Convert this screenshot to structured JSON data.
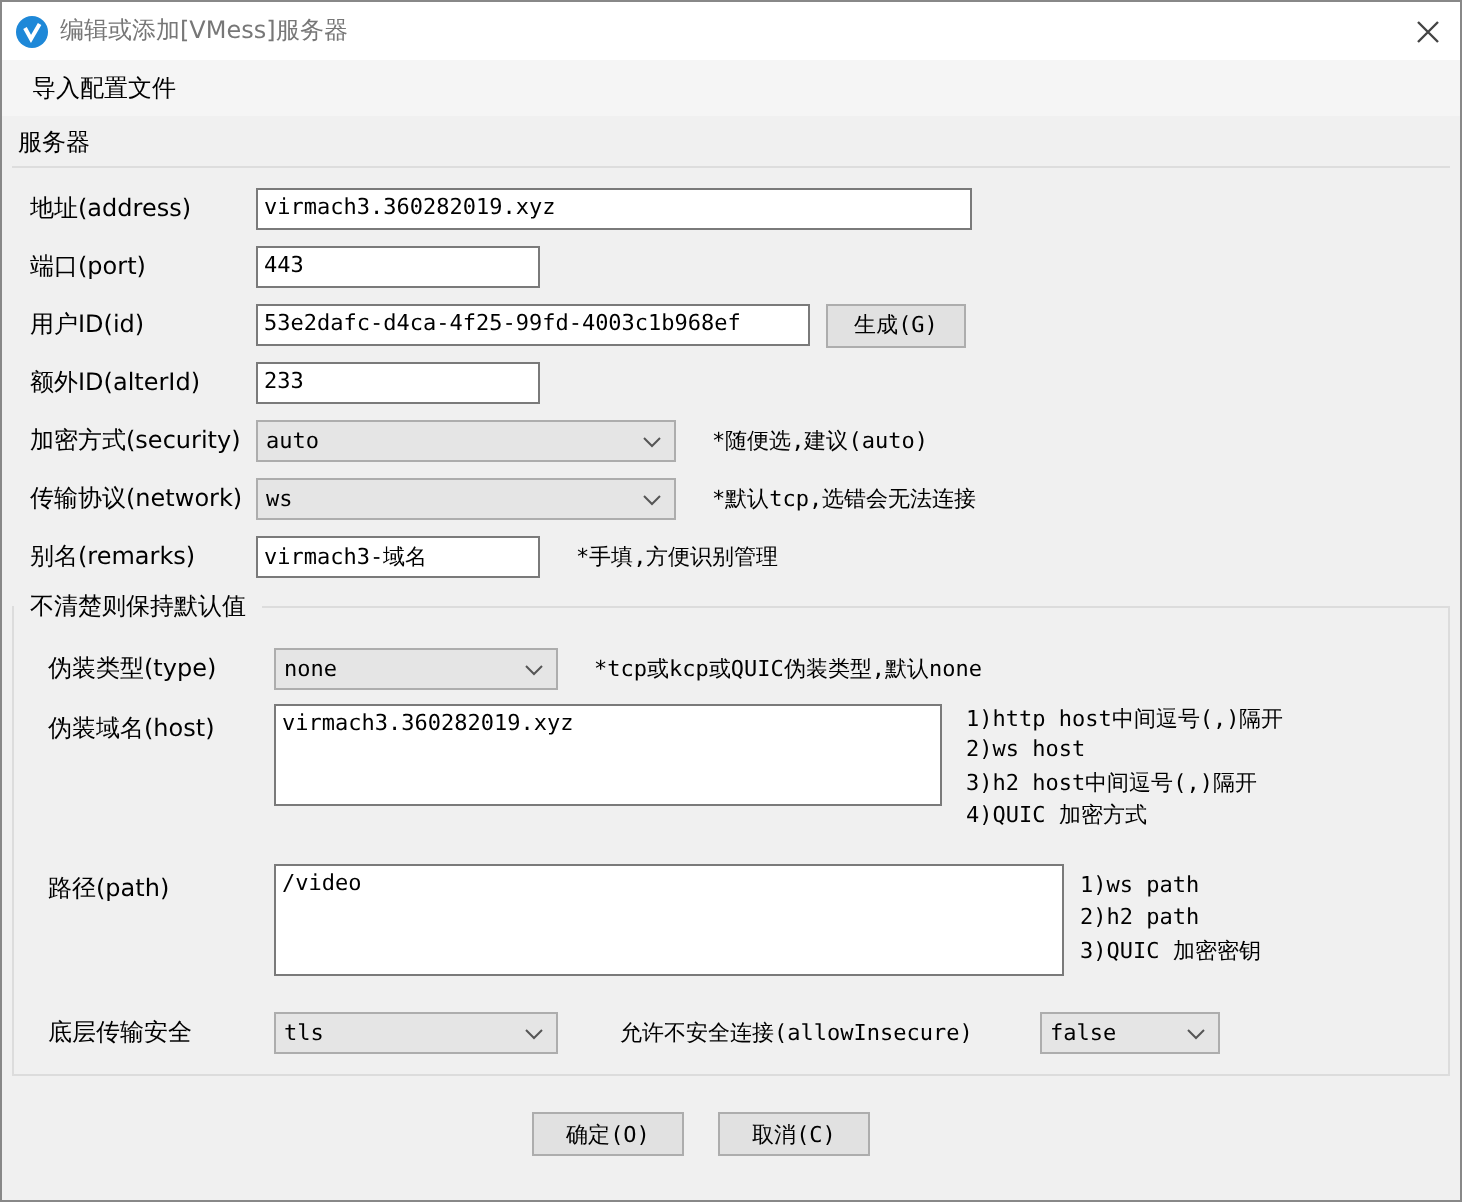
{
  "window": {
    "title": "编辑或添加[VMess]服务器"
  },
  "menu": [
    {
      "label": "导入配置文件"
    }
  ],
  "server": {
    "title": "服务器",
    "fields": [
      {
        "kind": "input",
        "label": "地址(address)",
        "value": "virmach3.360282019.xyz"
      },
      {
        "kind": "input",
        "label": "端口(port)",
        "value": "443"
      },
      {
        "kind": "input",
        "label": "用户ID(id)",
        "value": "53e2dafc-d4ca-4f25-99fd-4003c1b968ef",
        "button": "生成(G)"
      },
      {
        "kind": "input",
        "label": "额外ID(alterId)",
        "value": "233"
      },
      {
        "kind": "select",
        "label": "加密方式(security)",
        "value": "auto",
        "note": "*随便选,建议(auto)"
      },
      {
        "kind": "select",
        "label": "传输协议(network)",
        "value": "ws",
        "note": "*默认tcp,选错会无法连接"
      },
      {
        "kind": "input",
        "label": "别名(remarks)",
        "value": "virmach3-域名",
        "note": "*手填,方便识别管理"
      }
    ]
  },
  "advanced": {
    "title": "不清楚则保持默认值",
    "type": {
      "label": "伪装类型(type)",
      "value": "none",
      "note": "*tcp或kcp或QUIC伪装类型,默认none"
    },
    "host": {
      "label": "伪装域名(host)",
      "value": "virmach3.360282019.xyz",
      "notes": [
        "1)http host中间逗号(,)隔开",
        "2)ws host",
        "3)h2 host中间逗号(,)隔开",
        "4)QUIC 加密方式"
      ]
    },
    "path": {
      "label": "路径(path)",
      "value": "/video",
      "notes": [
        "1)ws path",
        "2)h2 path",
        "3)QUIC 加密密钥"
      ]
    },
    "security": {
      "label": "底层传输安全",
      "value": "tls"
    },
    "allow_insecure": {
      "label": "允许不安全连接(allowInsecure)",
      "value": "false"
    }
  },
  "buttons": [
    "确定(O)",
    "取消(C)"
  ]
}
